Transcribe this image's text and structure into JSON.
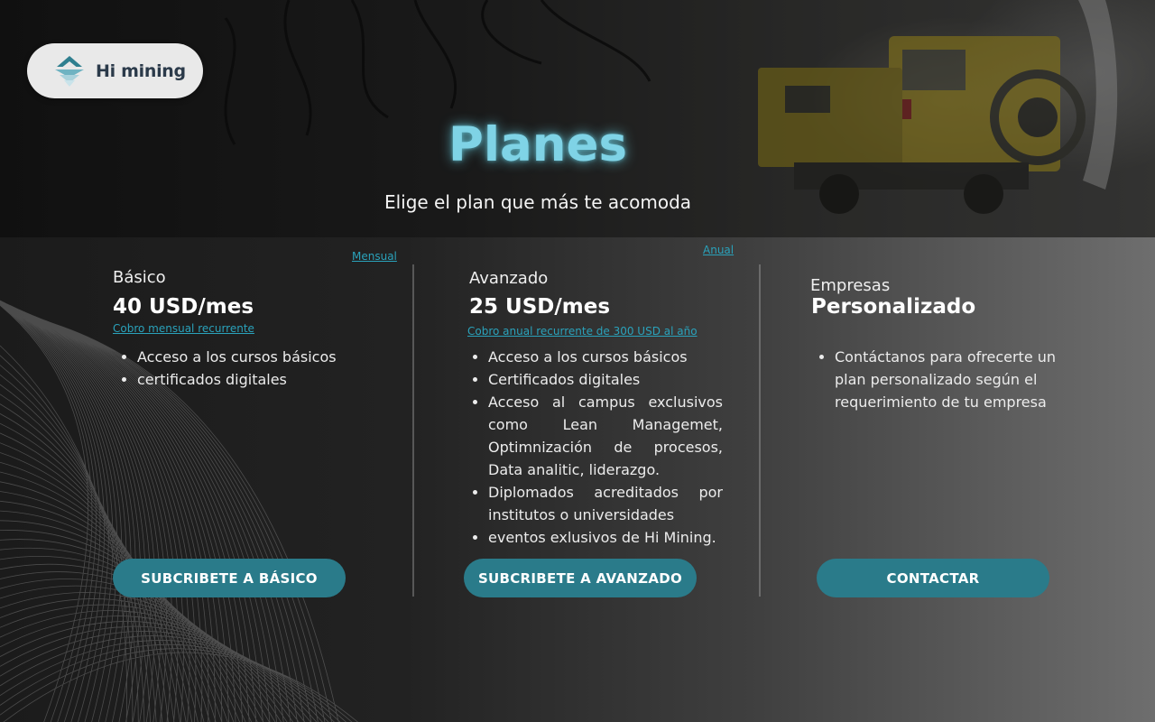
{
  "brand": {
    "name": "Hi mining"
  },
  "hero": {
    "title": "Planes",
    "subtitle": "Elige el plan que más te acomoda"
  },
  "billing_toggle": {
    "monthly_label": "Mensual",
    "annual_label": "Anual"
  },
  "plans": [
    {
      "name": "Básico",
      "price": "40 USD/mes",
      "billing_note": "Cobro mensual recurrente",
      "features": [
        "Acceso a los cursos básicos",
        "certificados digitales"
      ],
      "cta_label": "SUBCRIBETE A BÁSICO"
    },
    {
      "name": "Avanzado",
      "price": "25 USD/mes",
      "billing_note": "Cobro anual recurrente de 300 USD al año",
      "features": [
        "Acceso a los cursos básicos",
        "Certificados digitales",
        "Acceso al campus exclusivos como Lean Managemet, Optimnización de procesos, Data analitic, liderazgo.",
        "Diplomados acreditados por institutos o universidades",
        "eventos exlusivos de Hi Mining."
      ],
      "cta_label": "SUBCRIBETE A AVANZADO"
    },
    {
      "name": "Empresas",
      "price": "Personalizado",
      "features": [
        "Contáctanos para ofrecerte un plan personalizado según el requerimiento de tu empresa"
      ],
      "cta_label": "CONTACTAR"
    }
  ],
  "colors": {
    "accent": "#2a7b8a",
    "link": "#2aa2bb",
    "title_glow": "#7fd3e6"
  }
}
